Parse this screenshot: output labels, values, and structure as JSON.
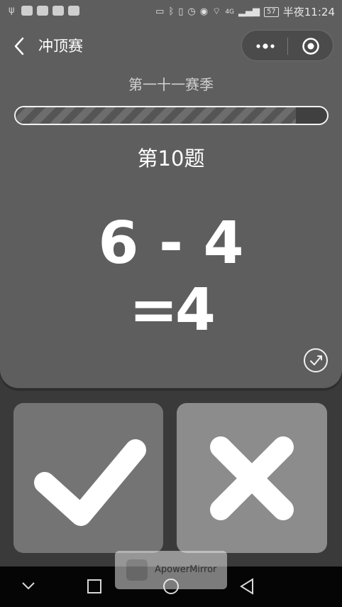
{
  "status_bar": {
    "left_icons": [
      "usb-icon",
      "app-icon",
      "wechat-icon",
      "play-icon",
      "app-icon-2"
    ],
    "right_icons": [
      "cast-icon",
      "bluetooth-icon",
      "vibrate-icon",
      "alarm-icon",
      "eye-icon",
      "wifi-icon",
      "signal-icon"
    ],
    "network": "4G",
    "battery": "57",
    "time": "半夜11:24"
  },
  "nav": {
    "title": "冲顶赛"
  },
  "game": {
    "season": "第一十一赛季",
    "progress": 0.9,
    "question_label": "第10题",
    "expression": "6 - 4",
    "answer": "=4"
  },
  "answers": {
    "correct_icon": "checkmark-icon",
    "wrong_icon": "cross-icon"
  },
  "watermark": {
    "text": "ApowerMirror"
  },
  "colors": {
    "background": "#5e5e5e",
    "button_true": "#747474",
    "button_false": "#8c8c8c"
  }
}
